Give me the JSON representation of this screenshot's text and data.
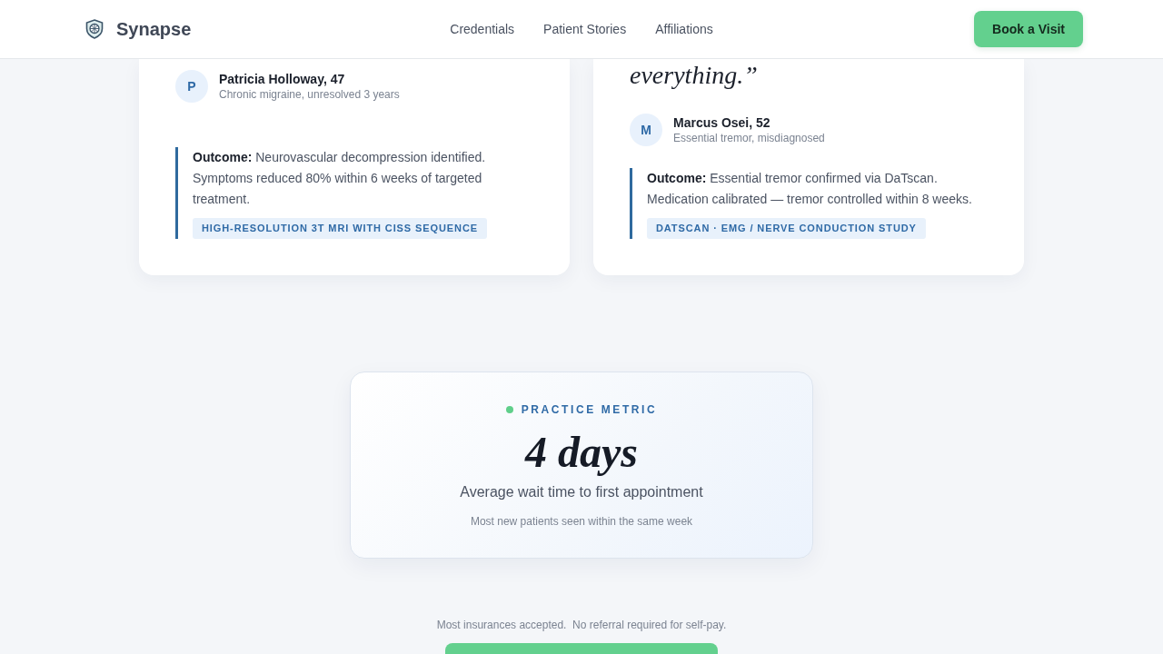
{
  "header": {
    "brand": "Synapse",
    "nav": [
      "Credentials",
      "Patient Stories",
      "Affiliations"
    ],
    "cta": "Book a Visit"
  },
  "stories": [
    {
      "initial": "P",
      "name": "Patricia Holloway, 47",
      "condition": "Chronic migraine, unresolved 3 years",
      "outcome": "**Outcome:** Neurovascular decompression identified. Symptoms reduced 80% within 6 weeks of targeted treatment.",
      "tag": "HIGH-RESOLUTION 3T MRI WITH CISS SEQUENCE"
    },
    {
      "quote": "everything.”",
      "initial": "M",
      "name": "Marcus Osei, 52",
      "condition": "Essential tremor, misdiagnosed",
      "outcome": "**Outcome:** Essential tremor confirmed via DaTscan. Medication calibrated — tremor controlled within 8 weeks.",
      "tag": "DATSCAN · EMG / NERVE CONDUCTION STUDY"
    }
  ],
  "metric": {
    "label": "PRACTICE METRIC",
    "value": "4 days",
    "caption": "Average wait time to first appointment",
    "note": "Most new patients seen within the same week"
  },
  "footnote": "Most insurances accepted.  No referral required for self-pay."
}
